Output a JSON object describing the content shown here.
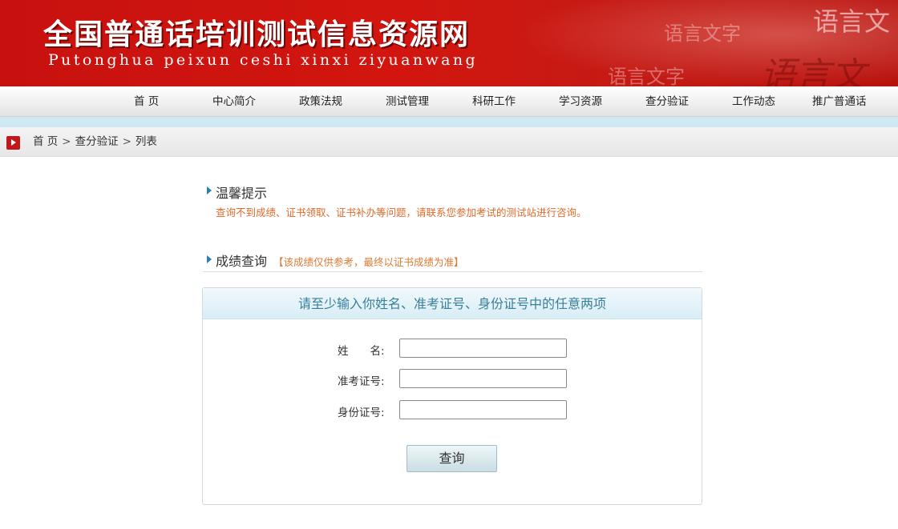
{
  "banner": {
    "title_cn": "全国普通话培训测试信息资源网",
    "title_pinyin": "Putonghua peixun ceshi xinxi ziyuanwang",
    "deco_texts": [
      "语言文",
      "语言文字",
      "语言文字",
      "语言文"
    ]
  },
  "nav": {
    "items": [
      "首 页",
      "中心简介",
      "政策法规",
      "测试管理",
      "科研工作",
      "学习资源",
      "查分验证",
      "工作动态",
      "推广普通话"
    ]
  },
  "breadcrumb": {
    "home": "首 页",
    "sep": ">",
    "level1": "查分验证",
    "level2": "列表"
  },
  "tip": {
    "title": "温馨提示",
    "text": "查询不到成绩、证书领取、证书补办等问题，请联系您参加考试的测试站进行咨询。"
  },
  "query_section": {
    "title": "成绩查询",
    "note": "【该成绩仅供参考，最终以证书成绩为准】"
  },
  "form": {
    "header": "请至少输入你姓名、准考证号、身份证号中的任意两项",
    "name_label": "姓　　名:",
    "name_value": "",
    "ticket_label": "准考证号:",
    "ticket_value": "",
    "id_label": "身份证号:",
    "id_value": "",
    "submit_label": "查询"
  },
  "colors": {
    "banner_red": "#c8110f",
    "accent_blue": "#2b7fb3",
    "warning_orange": "#e06a2a"
  }
}
